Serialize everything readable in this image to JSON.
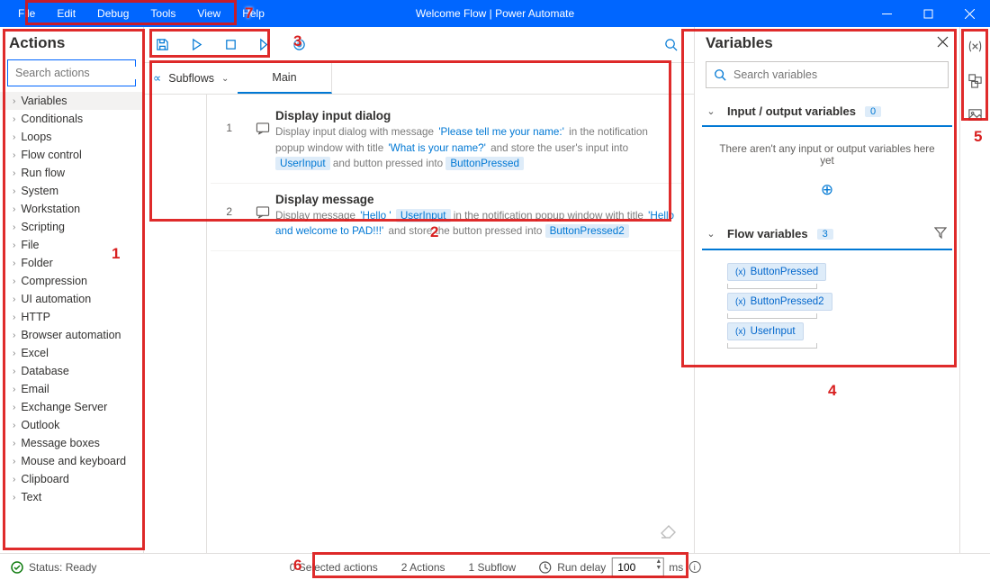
{
  "window": {
    "title": "Welcome Flow | Power Automate",
    "menu": [
      "File",
      "Edit",
      "Debug",
      "Tools",
      "View",
      "Help"
    ]
  },
  "toolbar": {
    "search_placeholder": ""
  },
  "actions": {
    "title": "Actions",
    "search_placeholder": "Search actions",
    "items": [
      "Variables",
      "Conditionals",
      "Loops",
      "Flow control",
      "Run flow",
      "System",
      "Workstation",
      "Scripting",
      "File",
      "Folder",
      "Compression",
      "UI automation",
      "HTTP",
      "Browser automation",
      "Excel",
      "Database",
      "Email",
      "Exchange Server",
      "Outlook",
      "Message boxes",
      "Mouse and keyboard",
      "Clipboard",
      "Text"
    ]
  },
  "subflows": {
    "label": "Subflows",
    "main_tab": "Main"
  },
  "steps": [
    {
      "num": "1",
      "title": "Display input dialog",
      "desc_pre": "Display input dialog with message ",
      "t1": "'Please tell me your name:'",
      "mid1": " in the notification popup window with title ",
      "t2": "'What is your name?'",
      "mid2": " and store the user's input into ",
      "v1": "UserInput",
      "mid3": " and button pressed into ",
      "v2": "ButtonPressed"
    },
    {
      "num": "2",
      "title": "Display message",
      "desc_pre": "Display message ",
      "t1": "'Hello '",
      "v1": "UserInput",
      "mid1": " in the notification popup window with title ",
      "t2": "'Hello and welcome to PAD!!!'",
      "mid2": " and store the button pressed into ",
      "v2": "ButtonPressed2"
    }
  ],
  "variables": {
    "title": "Variables",
    "search_placeholder": "Search variables",
    "io_section": "Input / output variables",
    "io_count": "0",
    "io_empty": "There aren't any input or output variables here yet",
    "flow_section": "Flow variables",
    "flow_count": "3",
    "flow_vars": [
      "ButtonPressed",
      "ButtonPressed2",
      "UserInput"
    ]
  },
  "status": {
    "ready": "Status: Ready",
    "selected": "0 Selected actions",
    "actions": "2 Actions",
    "subflow": "1 Subflow",
    "delay_label": "Run delay",
    "delay_value": "100",
    "delay_unit": "ms"
  },
  "annotations": [
    "1",
    "2",
    "3",
    "4",
    "5",
    "6",
    "7"
  ]
}
